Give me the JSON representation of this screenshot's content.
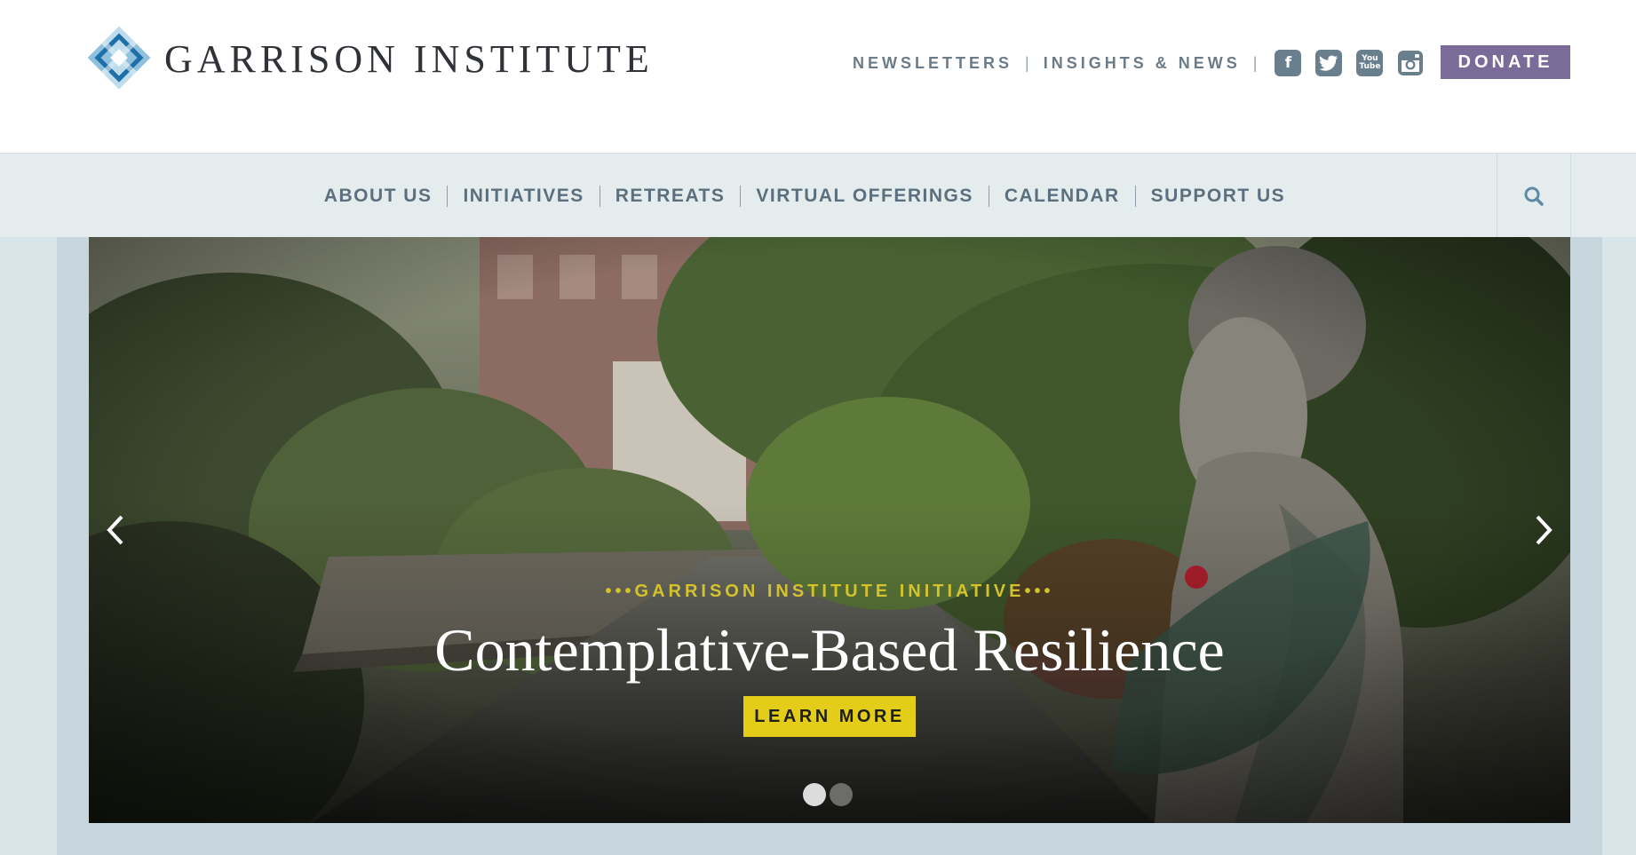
{
  "header": {
    "logo_text": "GARRISON INSTITUTE",
    "utility_links": [
      {
        "label": "NEWSLETTERS"
      },
      {
        "label": "INSIGHTS & NEWS"
      }
    ],
    "separator": "|",
    "social": [
      {
        "icon": "facebook-icon",
        "glyph": "f"
      },
      {
        "icon": "twitter-icon",
        "glyph": "t"
      },
      {
        "icon": "youtube-icon",
        "glyph_top": "You",
        "glyph_bottom": "Tube"
      },
      {
        "icon": "instagram-icon"
      }
    ],
    "donate_label": "DONATE"
  },
  "nav": {
    "items": [
      {
        "label": "ABOUT US"
      },
      {
        "label": "INITIATIVES"
      },
      {
        "label": "RETREATS"
      },
      {
        "label": "VIRTUAL OFFERINGS"
      },
      {
        "label": "CALENDAR"
      },
      {
        "label": "SUPPORT US"
      }
    ],
    "search_icon": "search-icon"
  },
  "hero": {
    "eyebrow": "•••GARRISON INSTITUTE INITIATIVE•••",
    "title": "Contemplative-Based Resilience",
    "cta_label": "LEARN MORE",
    "slide_count": 2,
    "active_slide": 1
  },
  "colors": {
    "donate_bg": "#7b6b98",
    "cta_bg": "#e3cd18",
    "eyebrow": "#d4c22c",
    "nav_text": "#5b6f7e",
    "nav_bg": "#e5ecee"
  }
}
